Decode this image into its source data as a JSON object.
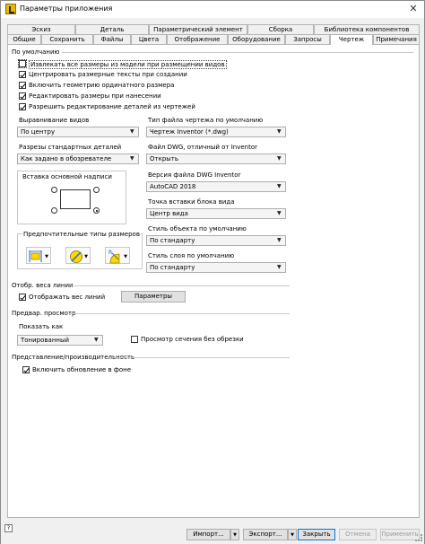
{
  "window": {
    "title": "Параметры приложения",
    "close_glyph": "✕",
    "help_glyph": "?"
  },
  "tabs_back": [
    "Эскиз",
    "Деталь",
    "Параметрический элемент",
    "Сборка",
    "Библиотека компонентов"
  ],
  "tabs_front": [
    "Общие",
    "Сохранить",
    "Файлы",
    "Цвета",
    "Отображение",
    "Оборудование",
    "Запросы",
    "Чертеж",
    "Примечания"
  ],
  "active_tab": "Чертеж",
  "defaults": {
    "heading": "По умолчанию",
    "checkboxes": [
      {
        "label": "Извлекать все размеры из модели при размещении видов",
        "checked": false
      },
      {
        "label": "Центрировать размерные тексты при создании",
        "checked": true
      },
      {
        "label": "Включить геометрию ординатного размера",
        "checked": true
      },
      {
        "label": "Редактировать размеры при нанесении",
        "checked": true
      },
      {
        "label": "Разрешить редактирование деталей из чертежей",
        "checked": true
      }
    ],
    "view_alignment": {
      "label": "Выравнивание видов",
      "value": "По центру"
    },
    "standard_parts_sizes": {
      "label": "Разрезы стандартных деталей",
      "value": "Как задано в обозревателе"
    },
    "default_drawing_type": {
      "label": "Тип файла чертежа по умолчанию",
      "value": "Чертеж Inventor (*.dwg)"
    },
    "non_inventor_dwg": {
      "label": "Файл DWG, отличный от Inventor",
      "value": "Открыть"
    },
    "title_block_insertion": {
      "label": "Вставка основной надписи"
    },
    "dwg_version": {
      "label": "Версия файла DWG Inventor",
      "value": "AutoCAD 2018"
    },
    "view_block_insertion": {
      "label": "Точка вставки блока вида",
      "value": "Центр вида"
    },
    "object_style": {
      "label": "Стиль объекта по умолчанию",
      "value": "По стандарту"
    },
    "layer_style": {
      "label": "Стиль слоя по умолчанию",
      "value": "По стандарту"
    },
    "preferred_dimension_types": {
      "label": "Предпочтительные типы размеров"
    }
  },
  "line_weights": {
    "heading": "Отобр. веса линии",
    "checkbox": {
      "label": "Отображать вес линий",
      "checked": true
    },
    "button": "Параметры"
  },
  "preview": {
    "heading": "Предвар. просмотр",
    "show_as": {
      "label": "Показать как",
      "value": "Тонированный"
    },
    "unclipped_checkbox": {
      "label": "Просмотр сечения без обрезки",
      "checked": false
    }
  },
  "performance": {
    "heading": "Представление/производительность",
    "checkbox": {
      "label": "Включить обновление в фоне",
      "checked": true
    }
  },
  "bottom_buttons": {
    "import": "Импорт...",
    "export": "Экспорт...",
    "close": "Закрыть",
    "cancel": "Отмена",
    "apply": "Применить"
  },
  "colors": {
    "primary_border": "#0078d7",
    "disabled_text": "#9a9a9a",
    "icon_yellow": "#ffd800",
    "icon_blue": "#1e64c8"
  }
}
